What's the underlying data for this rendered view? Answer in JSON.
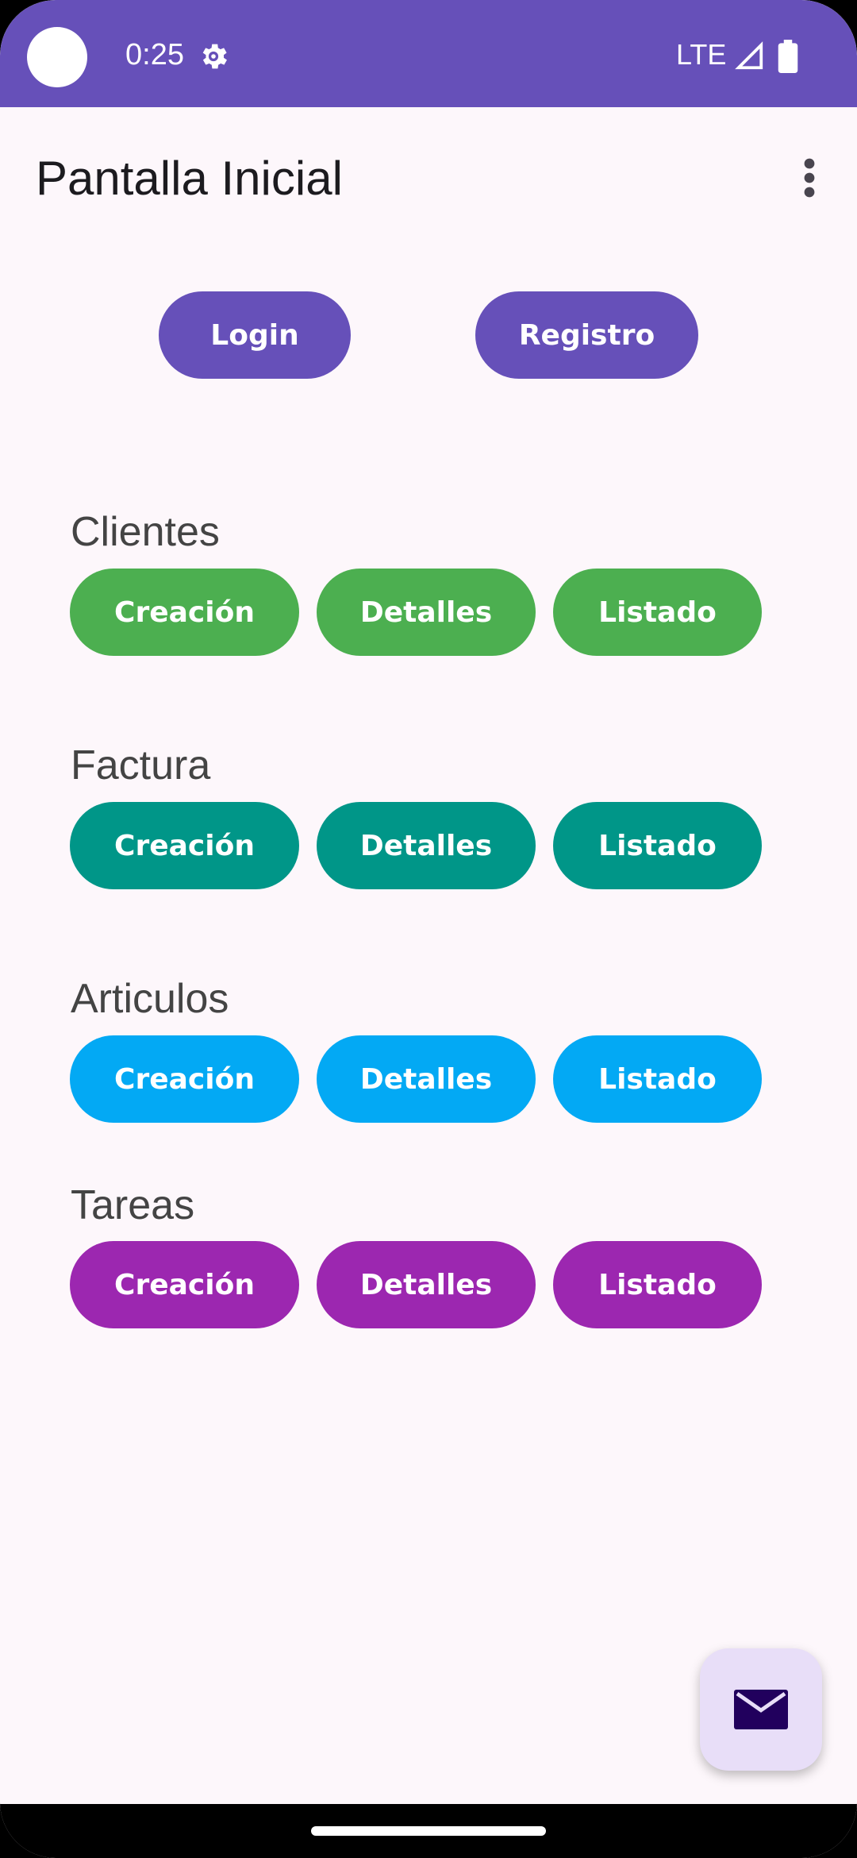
{
  "status_bar": {
    "time": "0:25",
    "network": "LTE",
    "icons": [
      "settings-icon",
      "signal-icon",
      "battery-icon"
    ]
  },
  "app_bar": {
    "title": "Pantalla Inicial",
    "menu_icon": "overflow-menu-icon"
  },
  "top_buttons": {
    "login": "Login",
    "registro": "Registro"
  },
  "sections": [
    {
      "label": "Clientes",
      "color": "#4CAF50",
      "buttons": [
        "Creación",
        "Detalles",
        "Listado"
      ]
    },
    {
      "label": "Factura",
      "color": "#009688",
      "buttons": [
        "Creación",
        "Detalles",
        "Listado"
      ]
    },
    {
      "label": "Articulos",
      "color": "#03A9F4",
      "buttons": [
        "Creación",
        "Detalles",
        "Listado"
      ]
    },
    {
      "label": "Tareas",
      "color": "#9C27B0",
      "buttons": [
        "Creación",
        "Detalles",
        "Listado"
      ]
    }
  ],
  "fab": {
    "icon": "mail-icon"
  },
  "colors": {
    "primary": "#6650B9",
    "background": "#FDF7FB",
    "fab_background": "#E8DEF8"
  }
}
